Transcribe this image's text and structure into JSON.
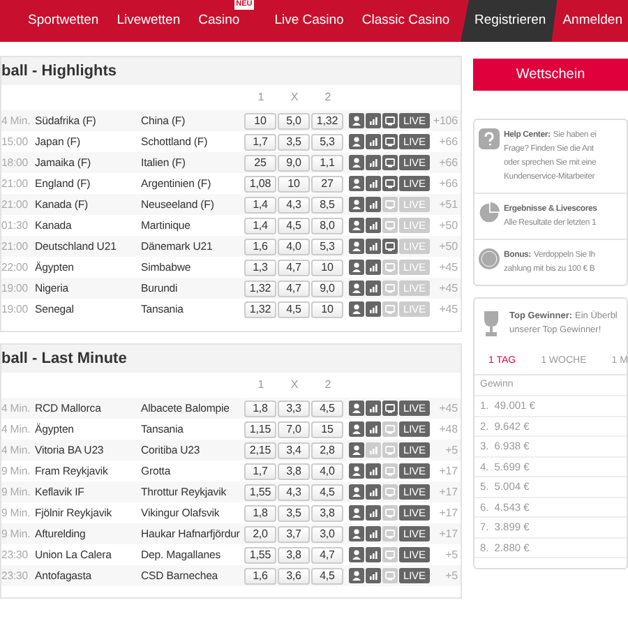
{
  "nav": {
    "items": [
      {
        "label": "Sportwetten"
      },
      {
        "label": "Livewetten"
      },
      {
        "label": "Casino",
        "badge": "NEU"
      },
      {
        "label": "Live Casino"
      },
      {
        "label": "Classic Casino"
      }
    ],
    "register": "Registrieren",
    "login": "Anmelden"
  },
  "sections": [
    {
      "title": "ball - Highlights",
      "odds_headers": [
        "1",
        "X",
        "2"
      ],
      "rows": [
        {
          "time": "4 Min.",
          "home": "Südafrika (F)",
          "away": "China (F)",
          "odds": [
            "10",
            "5,0",
            "1,32"
          ],
          "stats": true,
          "tv": true,
          "live": true,
          "badge": "LIVE",
          "more": "+106"
        },
        {
          "time": "15:00",
          "home": "Japan (F)",
          "away": "Schottland (F)",
          "odds": [
            "1,7",
            "3,5",
            "5,3"
          ],
          "stats": true,
          "tv": true,
          "live": true,
          "badge": "LIVE",
          "more": "+66"
        },
        {
          "time": "18:00",
          "home": "Jamaika (F)",
          "away": "Italien (F)",
          "odds": [
            "25",
            "9,0",
            "1,1"
          ],
          "stats": true,
          "tv": true,
          "live": true,
          "badge": "LIVE",
          "more": "+66"
        },
        {
          "time": "21:00",
          "home": "England (F)",
          "away": "Argentinien (F)",
          "odds": [
            "1,08",
            "10",
            "27"
          ],
          "stats": true,
          "tv": true,
          "live": true,
          "badge": "LIVE",
          "more": "+66"
        },
        {
          "time": "21:00",
          "home": "Kanada (F)",
          "away": "Neuseeland (F)",
          "odds": [
            "1,4",
            "4,3",
            "8,5"
          ],
          "stats": true,
          "tv": false,
          "live": false,
          "badge": "LIVE",
          "more": "+51"
        },
        {
          "time": "01:30",
          "home": "Kanada",
          "away": "Martinique",
          "odds": [
            "1,4",
            "4,5",
            "8,0"
          ],
          "stats": true,
          "tv": false,
          "live": false,
          "badge": "LIVE",
          "more": "+50"
        },
        {
          "time": "21:00",
          "home": "Deutschland U21",
          "away": "Dänemark U21",
          "odds": [
            "1,6",
            "4,0",
            "5,3"
          ],
          "stats": true,
          "tv": true,
          "live": false,
          "badge": "LIVE",
          "more": "+50"
        },
        {
          "time": "22:00",
          "home": "Ägypten",
          "away": "Simbabwe",
          "odds": [
            "1,3",
            "4,7",
            "10"
          ],
          "stats": true,
          "tv": false,
          "live": false,
          "badge": "LIVE",
          "more": "+45"
        },
        {
          "time": "19:00",
          "home": "Nigeria",
          "away": "Burundi",
          "odds": [
            "1,32",
            "4,7",
            "9,0"
          ],
          "stats": true,
          "tv": false,
          "live": false,
          "badge": "LIVE",
          "more": "+45"
        },
        {
          "time": "19:00",
          "home": "Senegal",
          "away": "Tansania",
          "odds": [
            "1,32",
            "4,5",
            "10"
          ],
          "stats": true,
          "tv": false,
          "live": false,
          "badge": "LIVE",
          "more": "+45"
        }
      ]
    },
    {
      "title": "ball - Last Minute",
      "odds_headers": [
        "1",
        "X",
        "2"
      ],
      "rows": [
        {
          "time": "4 Min.",
          "home": "RCD Mallorca",
          "away": "Albacete Balompie",
          "odds": [
            "1,8",
            "3,3",
            "4,5"
          ],
          "stats": true,
          "tv": true,
          "live": true,
          "badge": "LIVE",
          "more": "+45"
        },
        {
          "time": "4 Min.",
          "home": "Ägypten",
          "away": "Tansania",
          "odds": [
            "1,15",
            "7,0",
            "15"
          ],
          "stats": true,
          "tv": false,
          "live": true,
          "badge": "LIVE",
          "more": "+48"
        },
        {
          "time": "4 Min.",
          "home": "Vitoria BA U23",
          "away": "Coritiba U23",
          "odds": [
            "2,15",
            "3,4",
            "2,8"
          ],
          "stats": false,
          "tv": false,
          "live": true,
          "badge": "LIVE",
          "more": "+5"
        },
        {
          "time": "9 Min.",
          "home": "Fram Reykjavik",
          "away": "Grotta",
          "odds": [
            "1,7",
            "3,8",
            "4,0"
          ],
          "stats": true,
          "tv": false,
          "live": true,
          "badge": "LIVE",
          "more": "+17"
        },
        {
          "time": "9 Min.",
          "home": "Keflavik IF",
          "away": "Throttur Reykjavik",
          "odds": [
            "1,55",
            "4,3",
            "4,5"
          ],
          "stats": true,
          "tv": false,
          "live": true,
          "badge": "LIVE",
          "more": "+17"
        },
        {
          "time": "9 Min.",
          "home": "Fjölnir Reykjavik",
          "away": "Vikingur Olafsvik",
          "odds": [
            "1,8",
            "3,5",
            "3,8"
          ],
          "stats": true,
          "tv": false,
          "live": true,
          "badge": "LIVE",
          "more": "+17"
        },
        {
          "time": "9 Min.",
          "home": "Afturelding",
          "away": "Haukar Hafnarfjördur",
          "odds": [
            "2,0",
            "3,7",
            "3,0"
          ],
          "stats": true,
          "tv": false,
          "live": true,
          "badge": "LIVE",
          "more": "+17"
        },
        {
          "time": "23:30",
          "home": "Union La Calera",
          "away": "Dep. Magallanes",
          "odds": [
            "1,55",
            "3,8",
            "4,7"
          ],
          "stats": true,
          "tv": false,
          "live": true,
          "badge": "LIVE",
          "more": "+5"
        },
        {
          "time": "23:30",
          "home": "Antofagasta",
          "away": "CSD Barnechea",
          "odds": [
            "1,6",
            "3,6",
            "4,5"
          ],
          "stats": true,
          "tv": false,
          "live": true,
          "badge": "LIVE",
          "more": "+5"
        }
      ]
    }
  ],
  "betslip": {
    "label": "Wettschein"
  },
  "info": [
    {
      "kind": "help",
      "title": "Help Center:",
      "text": "Sie haben ei",
      "lines": [
        "Frage? Finden Sie die Ant",
        "oder sprechen Sie mit eine",
        "Kundenservice-Mitarbeiter"
      ]
    },
    {
      "kind": "results",
      "title": "Ergebnisse & Livescores",
      "lines": [
        "Alle Resultate der letzten 1"
      ]
    },
    {
      "kind": "bonus",
      "title": "Bonus:",
      "text": "Verdoppeln Sie Ih",
      "lines": [
        "zahlung mit bis zu 100 € B"
      ]
    }
  ],
  "top_winners": {
    "title": "Top Gewinner:",
    "lines": [
      "Ein Überbl",
      "unserer Top Gewinner!"
    ],
    "tabs": [
      {
        "label": "1 TAG",
        "selected": true
      },
      {
        "label": "1 WOCHE",
        "selected": false
      },
      {
        "label": "1 M",
        "selected": false
      }
    ],
    "column": "Gewinn",
    "rows": [
      {
        "rank": "1.",
        "amount": "49.001 €"
      },
      {
        "rank": "2.",
        "amount": "9.642 €"
      },
      {
        "rank": "3.",
        "amount": "6.938 €"
      },
      {
        "rank": "4.",
        "amount": "5.699 €"
      },
      {
        "rank": "5.",
        "amount": "5.004 €"
      },
      {
        "rank": "6.",
        "amount": "4.543 €"
      },
      {
        "rank": "7.",
        "amount": "3.899 €"
      },
      {
        "rank": "8.",
        "amount": "2.880 €"
      }
    ]
  }
}
